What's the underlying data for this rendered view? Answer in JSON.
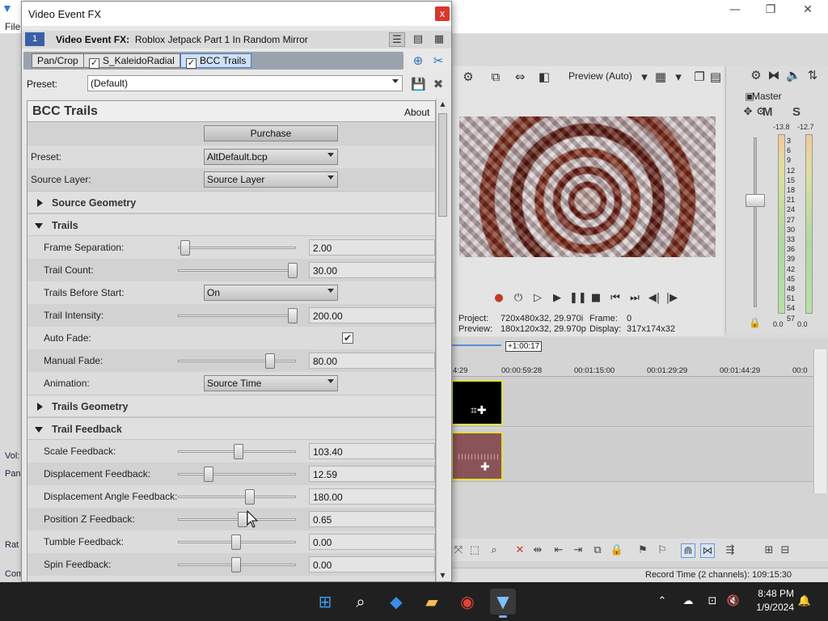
{
  "app": {
    "menu_file": "File"
  },
  "preview": {
    "mode": "Preview (Auto)",
    "project_label": "Project:",
    "project_value": "720x480x32, 29.970i",
    "frame_label": "Frame:",
    "frame_value": "0",
    "preview_label": "Preview:",
    "preview_value": "180x120x32, 29.970p",
    "display_label": "Display:",
    "display_value": "317x174x32"
  },
  "master": {
    "title": "Master",
    "m_label": "M",
    "s_label": "S",
    "db_left": "-13.8",
    "db_right": "-12.7",
    "scale": [
      "3",
      "6",
      "9",
      "12",
      "15",
      "18",
      "21",
      "24",
      "27",
      "30",
      "33",
      "36",
      "39",
      "42",
      "45",
      "48",
      "51",
      "54",
      "57"
    ],
    "bottom_left": "0.0",
    "bottom_right": "0.0"
  },
  "timeline": {
    "cursor_time": "+1:00:17",
    "ticks": [
      "4:29",
      "00:00:59:28",
      "00:01:15:00",
      "00:01:29:29",
      "00:01:44:29",
      "00:0"
    ],
    "record_time": "Record Time (2 channels): 109:15:30"
  },
  "left_strip": {
    "vol": "Vol:",
    "pan": "Pan",
    "rat": "Rat",
    "com": "Com"
  },
  "dialog": {
    "title": "Video Event FX",
    "close": "x",
    "fx_number": "1",
    "fx_label_bold": "Video Event FX:",
    "fx_label_name": "Roblox Jetpack Part 1 In Random Mirror",
    "chain": [
      "Pan/Crop",
      "S_KaleidoRadial",
      "BCC Trails"
    ],
    "preset_label": "Preset:",
    "preset_value": "(Default)"
  },
  "plugin": {
    "title": "BCC Trails",
    "about": "About",
    "purchase": "Purchase",
    "preset_label": "Preset:",
    "preset_value": "AltDefault.bcp",
    "source_layer_label": "Source Layer:",
    "source_layer_value": "Source Layer",
    "sec_source_geometry": "Source Geometry",
    "sec_trails": "Trails",
    "frame_sep_label": "Frame Separation:",
    "frame_sep_value": "2.00",
    "frame_sep_pos": 0.05,
    "trail_count_label": "Trail Count:",
    "trail_count_value": "30.00",
    "trail_count_pos": 1.0,
    "trails_before_label": "Trails Before Start:",
    "trails_before_value": "On",
    "trail_intensity_label": "Trail Intensity:",
    "trail_intensity_value": "200.00",
    "trail_intensity_pos": 1.0,
    "auto_fade_label": "Auto Fade:",
    "manual_fade_label": "Manual Fade:",
    "manual_fade_value": "80.00",
    "manual_fade_pos": 0.8,
    "animation_label": "Animation:",
    "animation_value": "Source Time",
    "sec_trails_geometry": "Trails Geometry",
    "sec_trail_feedback": "Trail Feedback",
    "scale_fb_label": "Scale Feedback:",
    "scale_fb_value": "103.40",
    "scale_fb_pos": 0.52,
    "disp_fb_label": "Displacement Feedback:",
    "disp_fb_value": "12.59",
    "disp_fb_pos": 0.26,
    "disp_angle_label": "Displacement Angle Feedback:",
    "disp_angle_value": "180.00",
    "disp_angle_pos": 0.62,
    "posz_fb_label": "Position Z Feedback:",
    "posz_fb_value": "0.65",
    "posz_fb_pos": 0.56,
    "tumble_fb_label": "Tumble Feedback:",
    "tumble_fb_value": "0.00",
    "tumble_fb_pos": 0.5,
    "spin_fb_label": "Spin Feedback:",
    "spin_fb_value": "0.00",
    "spin_fb_pos": 0.5
  },
  "taskbar": {
    "time": "8:48 PM",
    "date": "1/9/2024"
  }
}
